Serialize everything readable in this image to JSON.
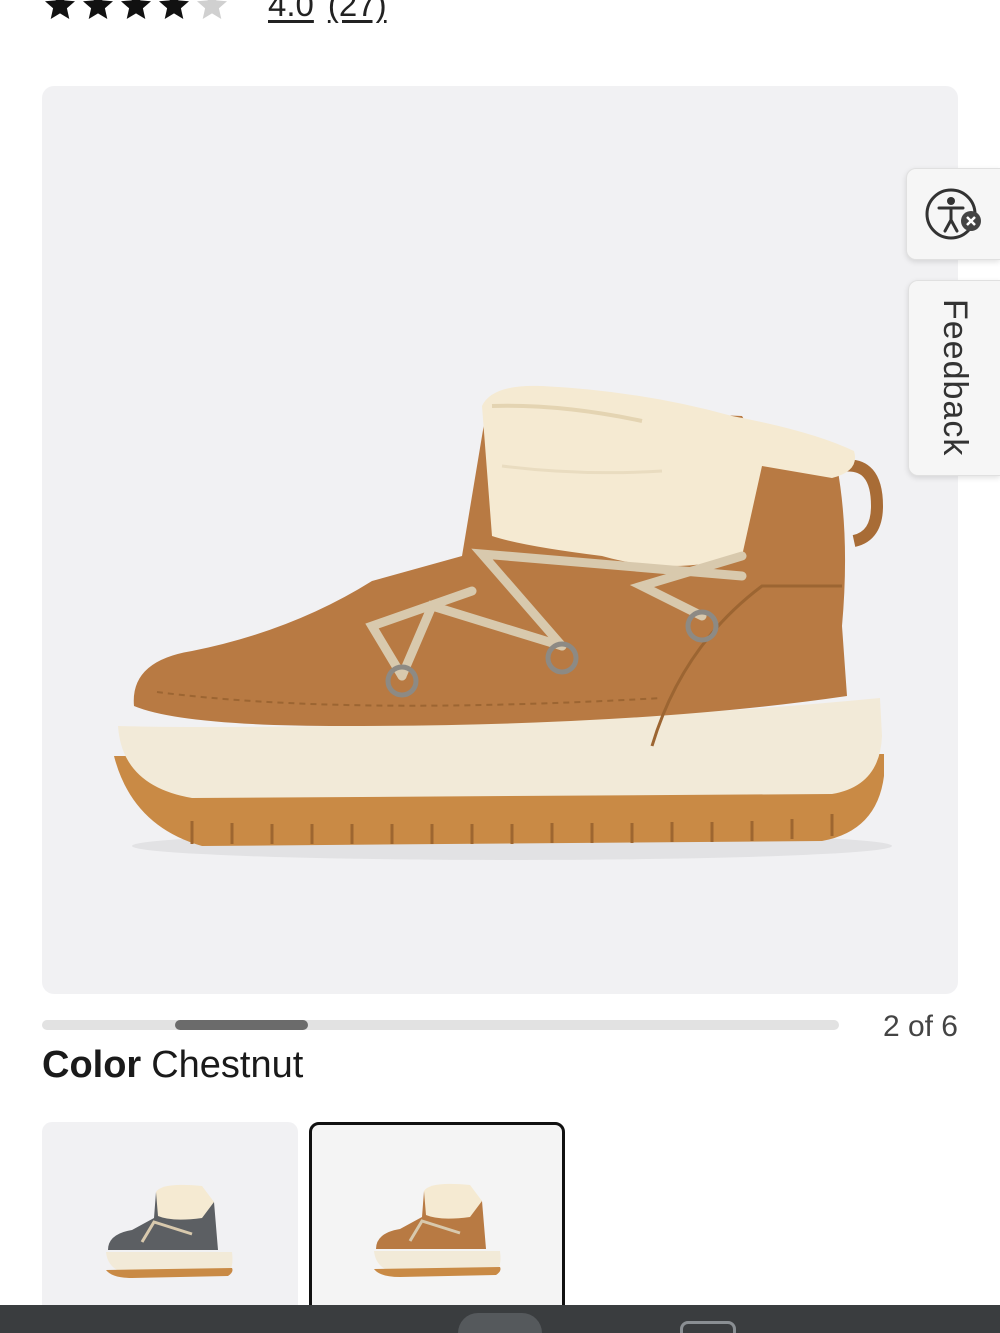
{
  "rating": {
    "value": "4.0",
    "count": "(27)",
    "stars_filled": 4,
    "stars_total": 5,
    "star_color": "#111111",
    "star_empty_color": "#d0d0d0"
  },
  "gallery": {
    "counter": "2 of 6",
    "current_index": 2,
    "total": 6,
    "main_image": "chestnut-boot-side-view"
  },
  "widgets": {
    "accessibility_icon": "accessibility-icon",
    "feedback_label": "Feedback"
  },
  "color": {
    "label": "Color",
    "value": "Chestnut",
    "swatches": [
      {
        "name": "grey-boot",
        "selected": false,
        "upper": "#5c5f63"
      },
      {
        "name": "chestnut-boot",
        "selected": true,
        "upper": "#b87a43"
      }
    ]
  },
  "colors": {
    "boot_chestnut": "#b87a43",
    "sole_cream": "#f2ead8",
    "outsole_gum": "#c98a45",
    "shearling": "#f5ead2"
  }
}
